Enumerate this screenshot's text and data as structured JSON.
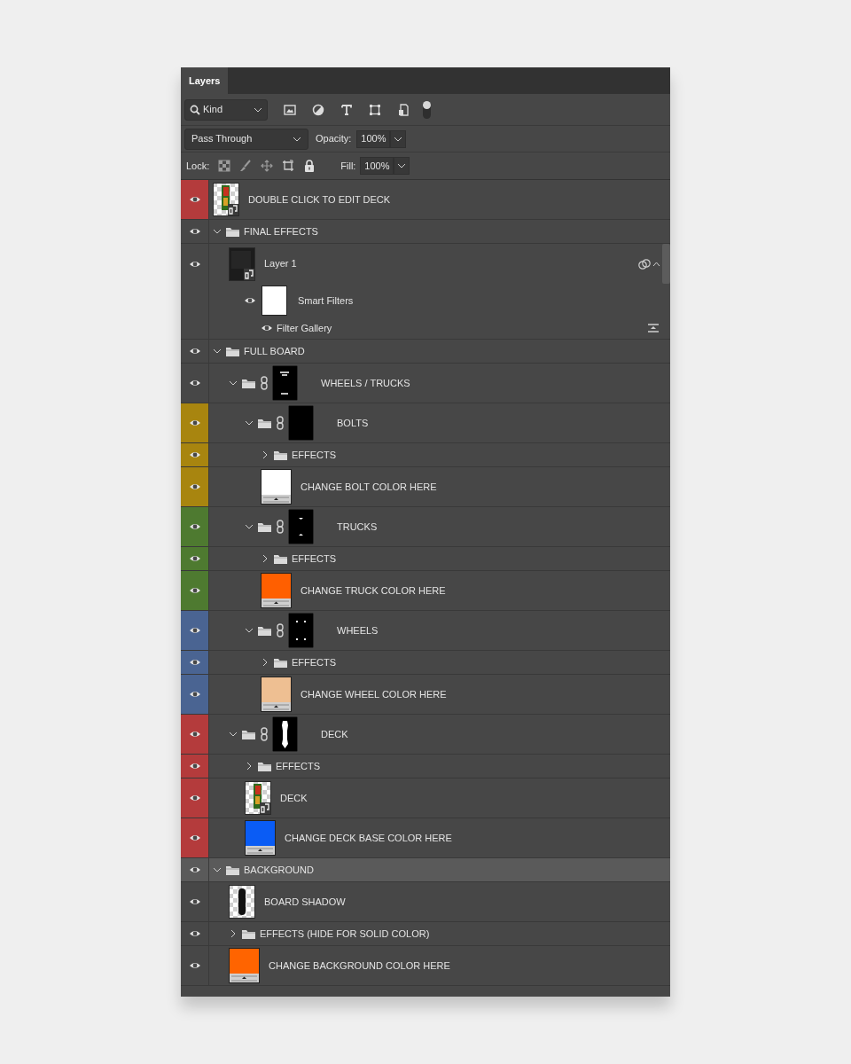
{
  "panel": {
    "tabs": [
      {
        "label": "Layers",
        "selected": true
      }
    ],
    "filter": {
      "value": "Kind",
      "toggle_on": true
    },
    "blend_mode": {
      "value": "Pass Through"
    },
    "opacity": {
      "label": "Opacity:",
      "value": "100%"
    },
    "lock": {
      "label": "Lock:"
    },
    "fill": {
      "label": "Fill:",
      "value": "100%"
    },
    "layers": [
      {
        "kind": "smart",
        "name": "DOUBLE CLICK TO EDIT DECK",
        "thumbnail": {
          "kind": "artwork"
        },
        "color": "#b43b3c",
        "visible": true,
        "selected": false
      },
      {
        "kind": "group",
        "name": "FINAL EFFECTS",
        "expanded": true,
        "visible": true,
        "selected": false,
        "children": [
          {
            "kind": "smart",
            "name": "Layer 1",
            "thumbnail": {
              "kind": "dark"
            },
            "visible": true,
            "selected": false,
            "filters_expanded": true,
            "filters": [
              {
                "kind": "smart_filters",
                "name": "Smart Filters",
                "visible": true
              },
              {
                "kind": "filter",
                "name": "Filter Gallery",
                "visible": true
              }
            ]
          }
        ]
      },
      {
        "kind": "group",
        "name": "FULL BOARD",
        "expanded": true,
        "visible": true,
        "selected": false,
        "children": [
          {
            "kind": "group",
            "name": "WHEELS / TRUCKS",
            "mask": {
              "kind": "dashes"
            },
            "expanded": true,
            "visible": true,
            "selected": false,
            "children": [
              {
                "kind": "group",
                "name": "BOLTS",
                "mask": {
                  "kind": "solid"
                },
                "color": "#a8850f",
                "expanded": true,
                "visible": true,
                "selected": false,
                "children": [
                  {
                    "kind": "group",
                    "name": "EFFECTS",
                    "color": "#a8850f",
                    "expanded": false,
                    "visible": true,
                    "selected": false
                  },
                  {
                    "kind": "fill",
                    "name": "CHANGE BOLT COLOR HERE",
                    "swatch": {
                      "color": "#ffffff"
                    },
                    "color": "#a8850f",
                    "visible": true,
                    "selected": false
                  }
                ]
              },
              {
                "kind": "group",
                "name": "TRUCKS",
                "mask": {
                  "kind": "trucks"
                },
                "color": "#4e7a30",
                "expanded": true,
                "visible": true,
                "selected": false,
                "children": [
                  {
                    "kind": "group",
                    "name": "EFFECTS",
                    "color": "#4e7a30",
                    "expanded": false,
                    "visible": true,
                    "selected": false
                  },
                  {
                    "kind": "fill",
                    "name": "CHANGE TRUCK COLOR HERE",
                    "swatch": {
                      "color": "#ff5f00"
                    },
                    "color": "#4e7a30",
                    "visible": true,
                    "selected": false
                  }
                ]
              },
              {
                "kind": "group",
                "name": "WHEELS",
                "mask": {
                  "kind": "dots"
                },
                "color": "#4a6492",
                "expanded": true,
                "visible": true,
                "selected": false,
                "children": [
                  {
                    "kind": "group",
                    "name": "EFFECTS",
                    "color": "#4a6492",
                    "expanded": false,
                    "visible": true,
                    "selected": false
                  },
                  {
                    "kind": "fill",
                    "name": "CHANGE WHEEL COLOR HERE",
                    "swatch": {
                      "color": "#eebf92"
                    },
                    "color": "#4a6492",
                    "visible": true,
                    "selected": false
                  }
                ]
              }
            ]
          },
          {
            "kind": "group",
            "name": "DECK",
            "mask": {
              "kind": "deck"
            },
            "color": "#b43b3c",
            "expanded": true,
            "visible": true,
            "selected": false,
            "children": [
              {
                "kind": "group",
                "name": "EFFECTS",
                "color": "#b43b3c",
                "expanded": false,
                "visible": true,
                "selected": false
              },
              {
                "kind": "smart",
                "name": "DECK",
                "thumbnail": {
                  "kind": "artwork"
                },
                "color": "#b43b3c",
                "visible": true,
                "selected": false
              },
              {
                "kind": "fill",
                "name": "CHANGE DECK BASE COLOR HERE",
                "swatch": {
                  "color": "#0a5cf5"
                },
                "color": "#b43b3c",
                "visible": true,
                "selected": false
              }
            ]
          }
        ]
      },
      {
        "kind": "group",
        "name": "BACKGROUND",
        "expanded": true,
        "visible": true,
        "selected": true,
        "children": [
          {
            "kind": "raster",
            "name": "BOARD SHADOW",
            "thumbnail": {
              "kind": "shadow"
            },
            "visible": true,
            "selected": false
          },
          {
            "kind": "group",
            "name": "EFFECTS (HIDE FOR SOLID COLOR)",
            "expanded": false,
            "visible": true,
            "selected": false
          },
          {
            "kind": "fill",
            "name": "CHANGE BACKGROUND COLOR HERE",
            "swatch": {
              "color": "#ff6400"
            },
            "visible": true,
            "selected": false
          }
        ]
      }
    ]
  }
}
